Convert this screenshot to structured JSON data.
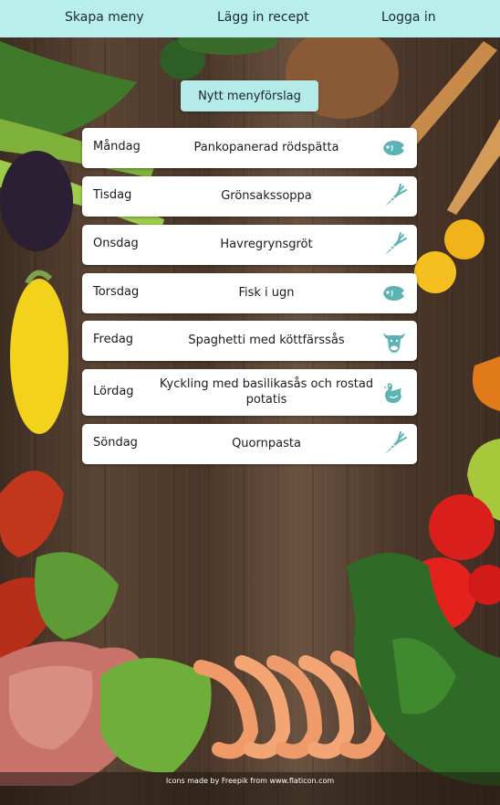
{
  "nav": {
    "create_menu": "Skapa meny",
    "add_recipe": "Lägg in recept",
    "login": "Logga in"
  },
  "new_menu_button": "Nytt menyförslag",
  "menu": [
    {
      "day": "Måndag",
      "dish": "Pankopanerad rödspätta",
      "icon": "fish-icon"
    },
    {
      "day": "Tisdag",
      "dish": "Grönsakssoppa",
      "icon": "carrot-icon"
    },
    {
      "day": "Onsdag",
      "dish": "Havregrynsgröt",
      "icon": "carrot-icon"
    },
    {
      "day": "Torsdag",
      "dish": "Fisk i ugn",
      "icon": "fish-icon"
    },
    {
      "day": "Fredag",
      "dish": "Spaghetti med köttfärssås",
      "icon": "cow-icon"
    },
    {
      "day": "Lördag",
      "dish": "Kyckling med basilikasås och rostad potatis",
      "icon": "chicken-icon"
    },
    {
      "day": "Söndag",
      "dish": "Quornpasta",
      "icon": "carrot-icon"
    }
  ],
  "footer": {
    "credit": "Icons made by Freepik from www.flaticon.com"
  },
  "colors": {
    "nav_bg": "#b8eeec",
    "button_bg": "#b4ebe9",
    "icon_color": "#5bb3b3",
    "card_bg": "#ffffff"
  }
}
